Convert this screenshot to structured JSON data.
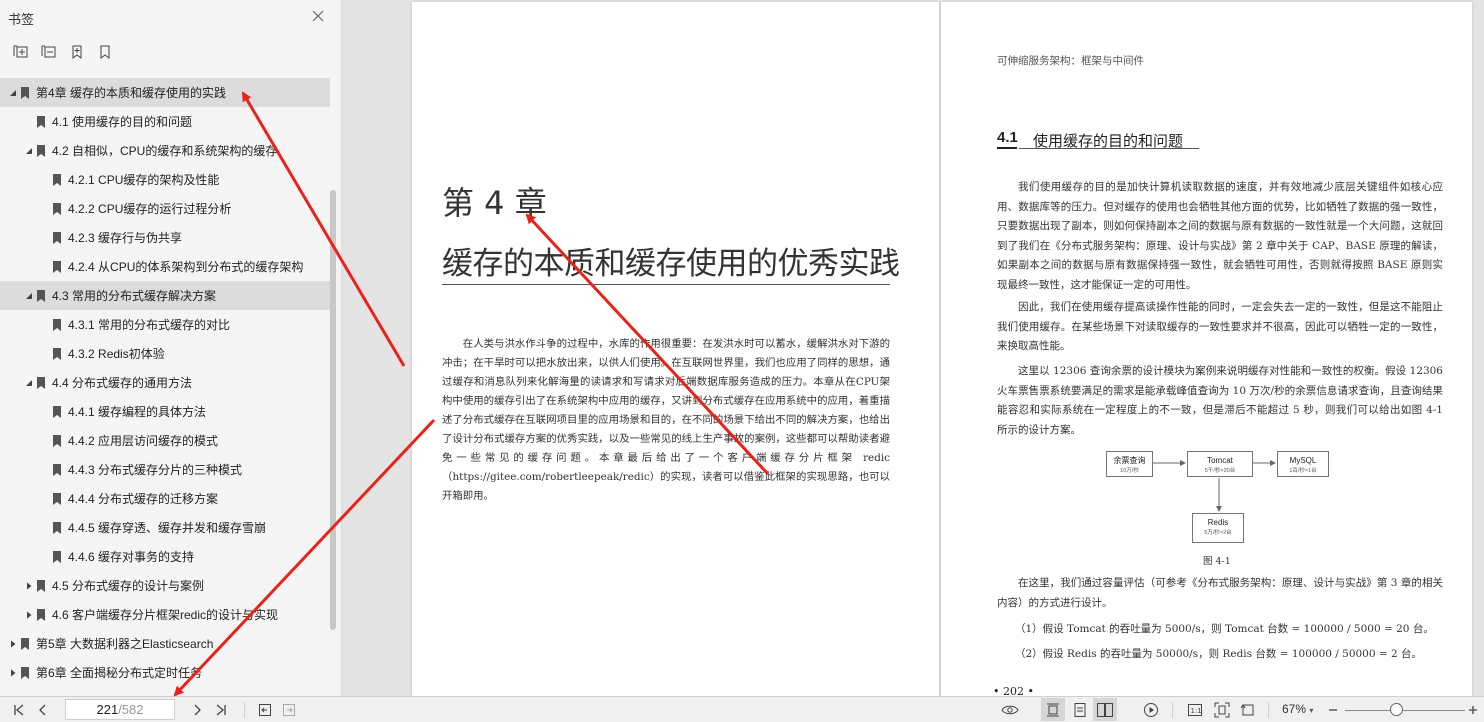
{
  "sidebar": {
    "title": "书签",
    "tools": [
      "expand-all-icon",
      "collapse-all-icon",
      "add-bookmark-icon",
      "bookmark-icon"
    ],
    "items": [
      {
        "label": "第4章 缓存的本质和缓存使用的实践",
        "level": 0,
        "expanded": true,
        "selected": true
      },
      {
        "label": "4.1 使用缓存的目的和问题",
        "level": 1,
        "expanded": null,
        "selected": false
      },
      {
        "label": "4.2 自相似，CPU的缓存和系统架构的缓存",
        "level": 1,
        "expanded": true,
        "selected": false
      },
      {
        "label": "4.2.1 CPU缓存的架构及性能",
        "level": 2,
        "expanded": null,
        "selected": false
      },
      {
        "label": "4.2.2 CPU缓存的运行过程分析",
        "level": 2,
        "expanded": null,
        "selected": false
      },
      {
        "label": "4.2.3 缓存行与伪共享",
        "level": 2,
        "expanded": null,
        "selected": false
      },
      {
        "label": "4.2.4 从CPU的体系架构到分布式的缓存架构",
        "level": 2,
        "expanded": null,
        "selected": false
      },
      {
        "label": "4.3 常用的分布式缓存解决方案",
        "level": 1,
        "expanded": true,
        "selected": true
      },
      {
        "label": "4.3.1 常用的分布式缓存的对比",
        "level": 2,
        "expanded": null,
        "selected": false
      },
      {
        "label": "4.3.2 Redis初体验",
        "level": 2,
        "expanded": null,
        "selected": false
      },
      {
        "label": "4.4 分布式缓存的通用方法",
        "level": 1,
        "expanded": true,
        "selected": false
      },
      {
        "label": "4.4.1 缓存编程的具体方法",
        "level": 2,
        "expanded": null,
        "selected": false
      },
      {
        "label": "4.4.2 应用层访问缓存的模式",
        "level": 2,
        "expanded": null,
        "selected": false
      },
      {
        "label": "4.4.3 分布式缓存分片的三种模式",
        "level": 2,
        "expanded": null,
        "selected": false
      },
      {
        "label": "4.4.4 分布式缓存的迁移方案",
        "level": 2,
        "expanded": null,
        "selected": false
      },
      {
        "label": "4.4.5 缓存穿透、缓存并发和缓存雪崩",
        "level": 2,
        "expanded": null,
        "selected": false
      },
      {
        "label": "4.4.6 缓存对事务的支持",
        "level": 2,
        "expanded": null,
        "selected": false
      },
      {
        "label": "4.5 分布式缓存的设计与案例",
        "level": 1,
        "expanded": false,
        "selected": false
      },
      {
        "label": "4.6 客户端缓存分片框架redic的设计与实现",
        "level": 1,
        "expanded": false,
        "selected": false
      },
      {
        "label": "第5章 大数据利器之Elasticsearch",
        "level": 0,
        "expanded": false,
        "selected": false
      },
      {
        "label": "第6章 全面揭秘分布式定时任务",
        "level": 0,
        "expanded": false,
        "selected": false
      }
    ]
  },
  "left_page": {
    "chapter_number": "第 4 章",
    "chapter_title": "缓存的本质和缓存使用的优秀实践",
    "intro": "在人类与洪水作斗争的过程中，水库的作用很重要：在发洪水时可以蓄水，缓解洪水对下游的冲击；在干旱时可以把水放出来，以供人们使用。在互联网世界里，我们也应用了同样的思想，通过缓存和消息队列来化解海量的读请求和写请求对后端数据库服务造成的压力。本章从在CPU架构中使用的缓存引出了在系统架构中应用的缓存，又讲到分布式缓存在应用系统中的应用，着重描述了分布式缓存在互联网项目里的应用场景和目的，在不同的场景下给出不同的解决方案，也给出了设计分布式缓存方案的优秀实践，以及一些常见的线上生产事故的案例，这些都可以帮助读者避免一些常见的缓存问题。本章最后给出了一个客户端缓存分片框架 redic（https://gitee.com/robertleepeak/redic）的实现，读者可以借鉴此框架的实现思路，也可以开箱即用。"
  },
  "right_page": {
    "running_head": "可伸缩服务架构：框架与中间件",
    "section_number": "4.1",
    "section_title": "使用缓存的目的和问题",
    "paragraphs": [
      "我们使用缓存的目的是加快计算机读取数据的速度，并有效地减少底层关键组件如核心应用、数据库等的压力。但对缓存的使用也会牺牲其他方面的优势，比如牺牲了数据的强一致性，只要数据出现了副本，则如何保持副本之间的数据与原有数据的一致性就是一个大问题，这就回到了我们在《分布式服务架构：原理、设计与实战》第 2 章中关于 CAP、BASE 原理的解读，如果副本之间的数据与原有数据保持强一致性，就会牺牲可用性，否则就得按照 BASE 原则实现最终一致性，这才能保证一定的可用性。",
      "因此，我们在使用缓存提高读操作性能的同时，一定会失去一定的一致性，但是这不能阻止我们使用缓存。在某些场景下对读取缓存的一致性要求并不很高，因此可以牺牲一定的一致性，来换取高性能。",
      "这里以 12306 查询余票的设计模块为案例来说明缓存对性能和一致性的权衡。假设 12306 火车票售票系统要满足的需求是能承载峰值查询为 10 万次/秒的余票信息请求查询，且查询结果能容忍和实际系统在一定程度上的不一致，但是滞后不能超过 5 秒，则我们可以给出如图 4-1 所示的设计方案。",
      "在这里，我们通过容量评估（可参考《分布式服务架构：原理、设计与实战》第 3 章的相关内容）的方式进行设计。"
    ],
    "list_items": [
      "（1）假设 Tomcat 的吞吐量为 5000/s，则 Tomcat 台数 = 100000 / 5000 = 20 台。",
      "（2）假设 Redis 的吞吐量为 50000/s，则 Redis 台数 = 100000 / 50000 = 2 台。"
    ],
    "figure": {
      "caption": "图 4-1",
      "boxes": [
        {
          "title": "余票查询",
          "sub": "10万/秒"
        },
        {
          "title": "Tomcat",
          "sub": "5千/秒×20台"
        },
        {
          "title": "MySQL",
          "sub": "1百/秒×1台"
        },
        {
          "title": "Redis",
          "sub": "5万/秒×2台"
        }
      ]
    },
    "page_number": "• 202 •"
  },
  "bottombar": {
    "current_page": "221",
    "total_pages": "/582",
    "zoom": "67%"
  },
  "colors": {
    "annotation_arrow": "#e8231c",
    "sidebar_bg": "#f5f5f5",
    "selection": "#dcdcdc"
  }
}
